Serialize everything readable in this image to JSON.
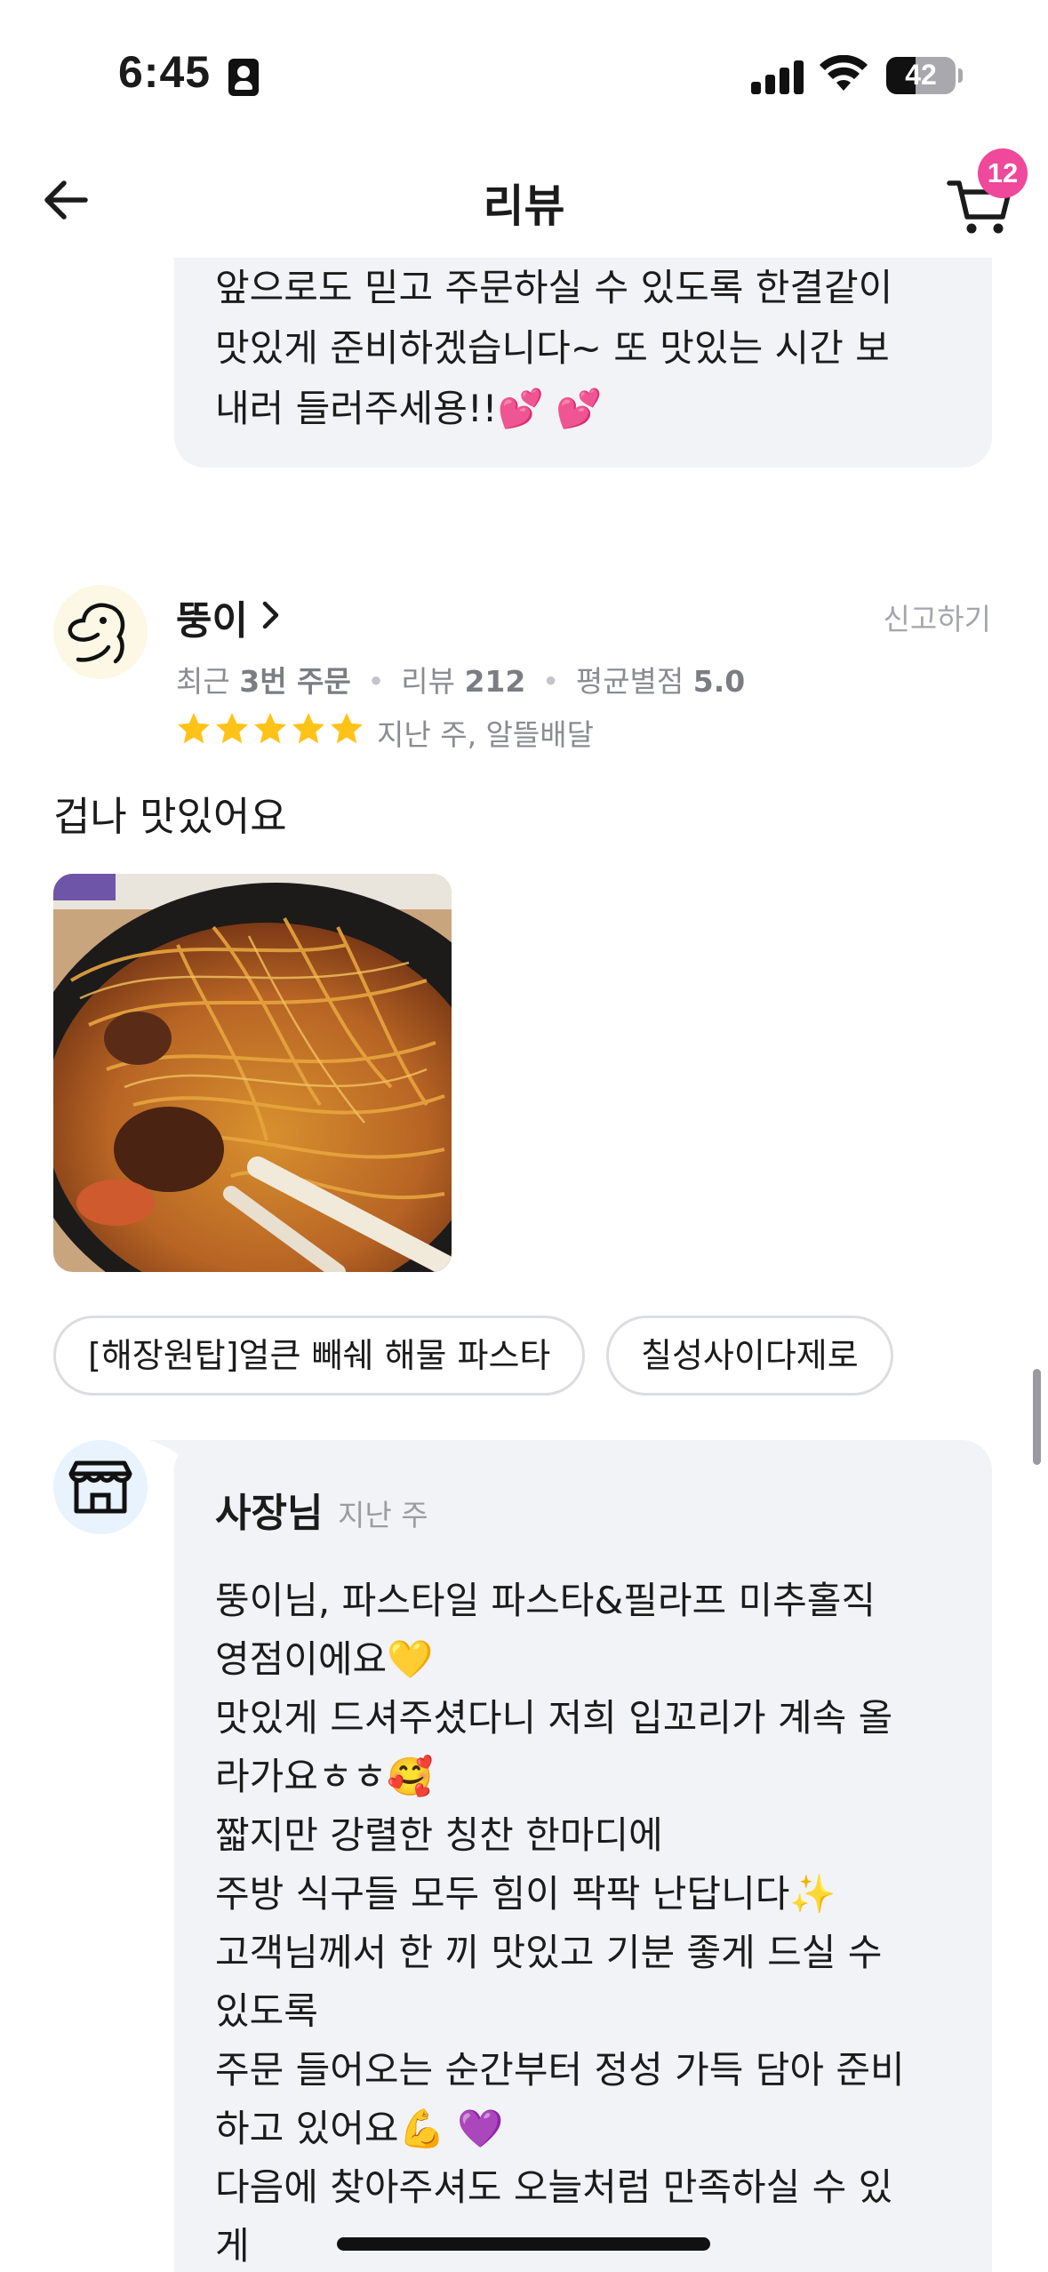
{
  "status_bar": {
    "time": "6:45",
    "battery_level": "42"
  },
  "header": {
    "title": "리뷰",
    "cart_count": "12"
  },
  "previous_reply": {
    "text": "앞으로도 믿고 주문하실 수 있도록 한결같이\n맛있게 준비하겠습니다~ 또 맛있는 시간 보\n내러 들러주세용!!💕 💕"
  },
  "review": {
    "reviewer_name": "뚱이",
    "report_label": "신고하기",
    "stats": {
      "recent_prefix": "최근",
      "order_count": "3번 주문",
      "review_prefix": "리뷰",
      "review_count": "212",
      "avg_prefix": "평균별점",
      "avg_rating": "5.0"
    },
    "rating": 5,
    "meta": "지난 주, 알뜰배달",
    "body": "겁나 맛있어요",
    "menu_chips": [
      "[해장원탑]얼큰 빼쉐 해물 파스타",
      "칠성사이다제로"
    ]
  },
  "owner_reply": {
    "name": "사장님",
    "date": "지난 주",
    "lines": [
      "뚱이님, 파스타일 파스타&필라프 미추홀직",
      "영점이에요💛",
      "맛있게 드셔주셨다니 저희 입꼬리가 계속 올",
      "라가요ㅎㅎ🥰",
      "짧지만 강렬한 칭찬 한마디에",
      "주방 식구들 모두 힘이 팍팍 난답니다✨",
      "고객님께서 한 끼 맛있고 기분 좋게 드실 수",
      "있도록",
      "주문 들어오는 순간부터 정성 가득 담아 준비",
      "하고 있어요💪 💜",
      "다음에 찾아주셔도 오늘처럼 만족하실 수 있",
      "게"
    ]
  },
  "colors": {
    "badge": "#f0489a",
    "star": "#ffc318",
    "bubble": "#f2f3f6"
  }
}
